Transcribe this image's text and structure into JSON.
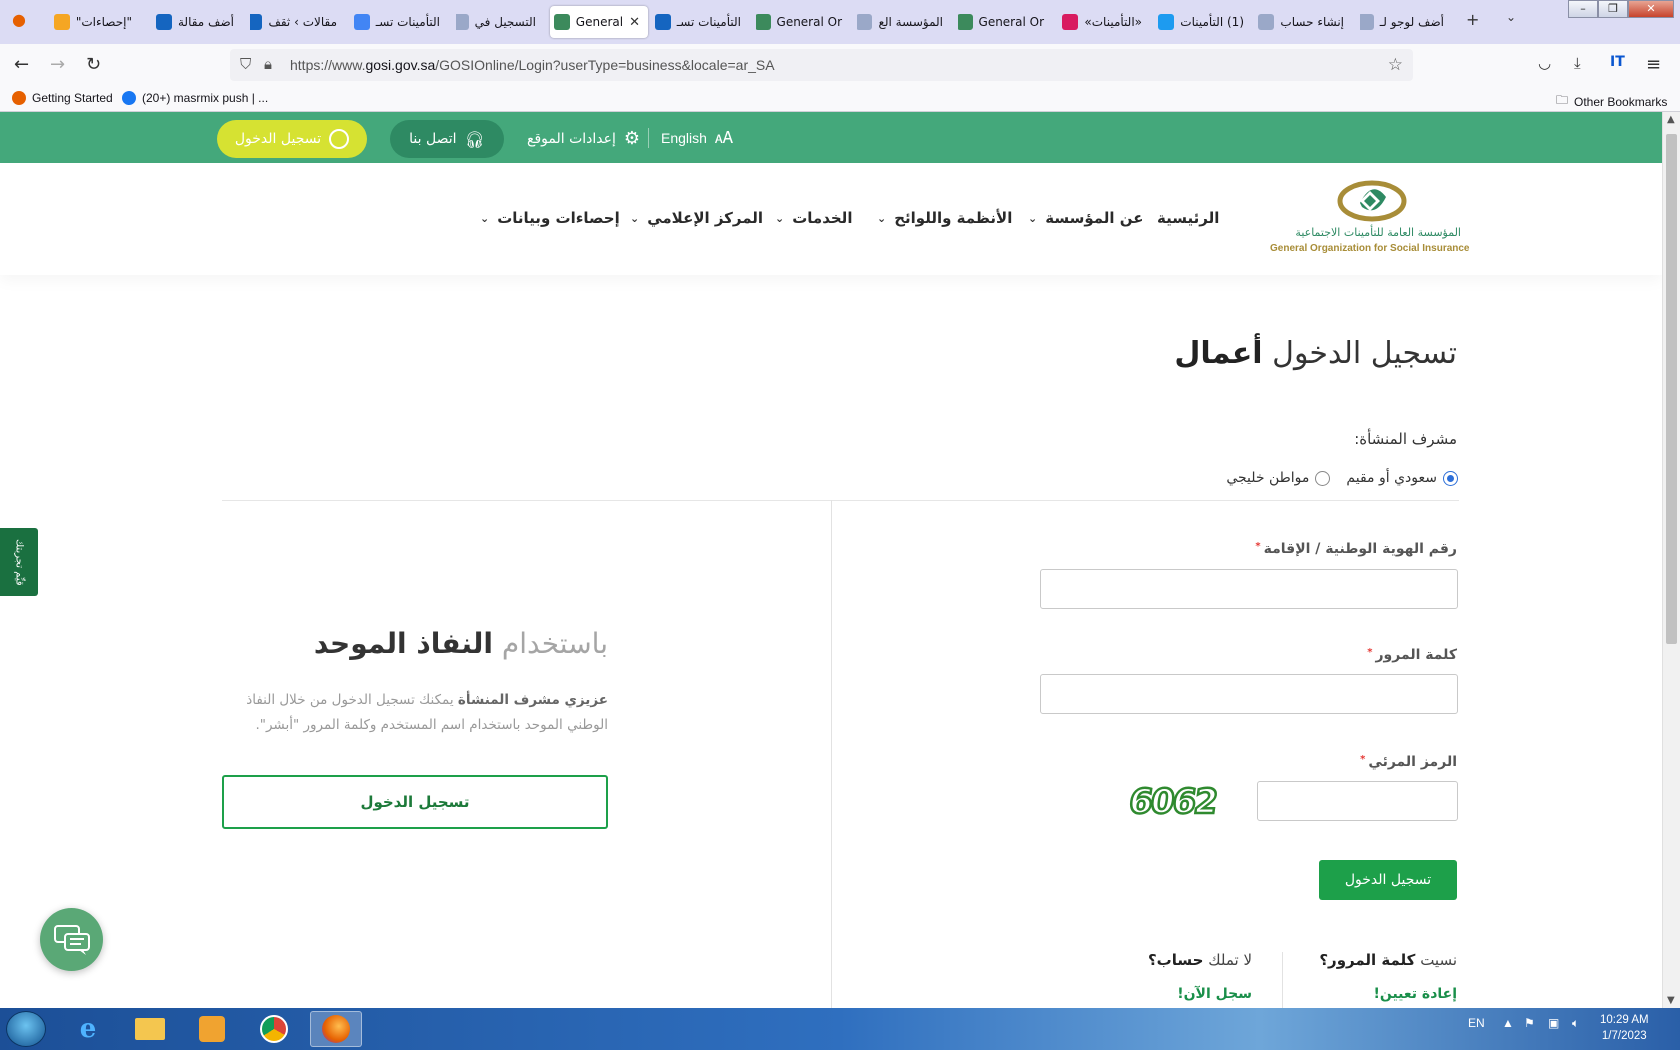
{
  "browser": {
    "tabs": [
      {
        "label": "\"إحصاءات\"",
        "color": "#f5a623"
      },
      {
        "label": "أضف مقالة",
        "color": "#1565c0"
      },
      {
        "label": "مقالات › ثقف",
        "color": "#1565c0"
      },
      {
        "label": "التأمينات تسـ",
        "color": "#4285f4"
      },
      {
        "label": "التسجيل في",
        "color": "#9aa8c8"
      },
      {
        "label": "General",
        "color": "#3c8a5c"
      },
      {
        "label": "التأمينات تسـ",
        "color": "#1565c0"
      },
      {
        "label": "General Or",
        "color": "#3c8a5c"
      },
      {
        "label": "المؤسسة الع",
        "color": "#9aa8c8"
      },
      {
        "label": "General Or",
        "color": "#3c8a5c"
      },
      {
        "label": "«التأمينات»",
        "color": "#d81b60"
      },
      {
        "label": "(1) التأمينات",
        "color": "#1d9bf0"
      },
      {
        "label": "إنشاء حساب",
        "color": "#9aa8c8"
      },
      {
        "label": "أضف لوجو لـ",
        "color": "#9aa8c8"
      }
    ],
    "url_prefix": "https://www.",
    "url_domain": "gosi.gov.sa",
    "url_rest": "/GOSIOnline/Login?userType=business&locale=ar_SA",
    "bookmarks": {
      "getting_started": "Getting Started",
      "fb": "(20+) masrmix push | ...",
      "other": "Other Bookmarks"
    }
  },
  "topbar": {
    "login": "تسجيل الدخول",
    "contact": "اتصل بنا",
    "settings": "إعدادات الموقع",
    "language": "English"
  },
  "nav": {
    "home": "الرئيسية",
    "about": "عن المؤسسة",
    "regulations": "الأنظمة واللوائح",
    "services": "الخدمات",
    "media": "المركز الإعلامي",
    "stats": "إحصاءات وبيانات"
  },
  "logo": {
    "ar": "المؤسسة العامة للتأمينات الاجتماعية",
    "en": "General Organization for Social Insurance"
  },
  "login": {
    "title_prefix": "تسجيل الدخول",
    "title_bold": "أعمال",
    "owner_label": "مشرف المنشأة:",
    "radio_saudi": "سعودي أو مقيم",
    "radio_gulf": "مواطن خليجي",
    "id_label": "رقم الهوية الوطنية / الإقامة",
    "password_label": "كلمة المرور",
    "captcha_label": "الرمز المرئي",
    "required_mark": "*",
    "captcha_text": "6062",
    "submit": "تسجيل الدخول",
    "forgot_prefix": "نسيت",
    "forgot_bold": "كلمة المرور؟",
    "reset_link": "إعادة تعيين!",
    "noacc_prefix": "لا تملك",
    "noacc_bold": "حساب؟",
    "register_link": "سجل الآن!"
  },
  "sso": {
    "title_light": "باستخدام",
    "title_bold": "النفاذ الموحد",
    "desc_bold": "عزيزي مشرف المنشأة",
    "desc_rest": "يمكنك تسجيل الدخول من خلال النفاذ الوطني الموحد باستخدام اسم المستخدم وكلمة المرور \"أبشر\".",
    "button": "تسجيل الدخول"
  },
  "side_tab": "قيِّم تجربتك",
  "taskbar": {
    "lang": "EN",
    "time": "10:29 AM",
    "date": "1/7/2023"
  },
  "colors": {
    "brand_green": "#44a87b",
    "button_green": "#1da04a",
    "login_pill": "#d6e232"
  }
}
